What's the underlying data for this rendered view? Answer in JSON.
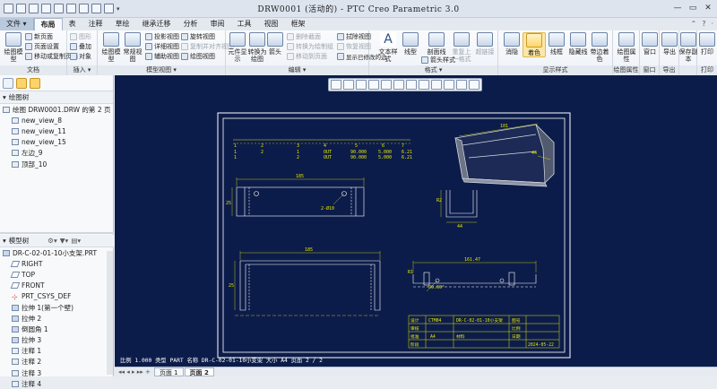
{
  "titlebar": {
    "title": "DRW0001 (活动的) - PTC Creo Parametric 3.0",
    "minimize": "—",
    "maximize": "▭",
    "close": "✕"
  },
  "menu": {
    "file": "文件 ▾",
    "tabs": [
      "布局",
      "表",
      "注释",
      "草绘",
      "继承迁移",
      "分析",
      "审阅",
      "工具",
      "视图",
      "框架"
    ],
    "active_tab": "布局",
    "right_icons": [
      "⌃",
      "?",
      "·"
    ]
  },
  "ribbon": {
    "groups": {
      "document": {
        "label": "文档",
        "big_button": "绘图模型",
        "items": [
          "新页面",
          "页面设置",
          "移动或复制页面"
        ]
      },
      "insert": {
        "label": "插入 ▾",
        "items": [
          "图形",
          "叠加",
          "对象"
        ]
      },
      "model_views": {
        "label": "模型视图 ▾",
        "big_buttons": [
          "绘图模型",
          "常规视图"
        ],
        "items": [
          "投影视图",
          "详细视图",
          "辅助视图",
          "旋转视图",
          "复制并对齐视图",
          "绘图视图"
        ]
      },
      "edit": {
        "label": "编辑 ▾",
        "big_buttons": [
          "元件显示",
          "转换为绘图",
          "箭头"
        ],
        "items": [
          "删除截面",
          "转换为绘制组",
          "移动到页面",
          "拭除视图",
          "恢复视图",
          "显示已修改的边"
        ]
      },
      "format": {
        "label": "格式 ▾",
        "big_buttons": [
          "文本样式",
          "线型",
          "剖面线",
          "重复上一格式",
          "超链接"
        ],
        "items": [
          "箭头样式"
        ]
      },
      "display_style": {
        "label": "显示样式",
        "big_buttons": [
          "消隐",
          "着色",
          "线框",
          "隐藏线",
          "带边着色"
        ],
        "selected": "着色"
      },
      "sheet_props": {
        "label": "绘图属性",
        "big_button": "绘图属性"
      },
      "window": {
        "label": "窗口",
        "big_button": "窗口"
      },
      "export": {
        "label": "导出",
        "big_button": "导出"
      },
      "save_copy": {
        "label": "",
        "big_button": "保存副本"
      },
      "print": {
        "label": "打印",
        "big_button": "打印"
      }
    }
  },
  "drawing_tree": {
    "header": "绘图树",
    "items": [
      {
        "label": "绘图 DRW0001.DRW 的第 2 页",
        "level": 0
      },
      {
        "label": "new_view_8",
        "level": 1
      },
      {
        "label": "new_view_11",
        "level": 1
      },
      {
        "label": "new_view_15",
        "level": 1
      },
      {
        "label": "左边_9",
        "level": 1
      },
      {
        "label": "顶部_10",
        "level": 1
      }
    ]
  },
  "model_tree": {
    "header": "模型树",
    "items": [
      {
        "label": "DR-C-02-01-10小支架.PRT",
        "level": 0,
        "kind": "part"
      },
      {
        "label": "RIGHT",
        "level": 1,
        "kind": "plane"
      },
      {
        "label": "TOP",
        "level": 1,
        "kind": "plane"
      },
      {
        "label": "FRONT",
        "level": 1,
        "kind": "plane"
      },
      {
        "label": "PRT_CSYS_DEF",
        "level": 1,
        "kind": "csys"
      },
      {
        "label": "拉伸 1(第一个壁)",
        "level": 1,
        "kind": "feat"
      },
      {
        "label": "拉伸 2",
        "level": 1,
        "kind": "feat"
      },
      {
        "label": "倒圆角 1",
        "level": 1,
        "kind": "feat"
      },
      {
        "label": "拉伸 3",
        "level": 1,
        "kind": "feat"
      },
      {
        "label": "注释 1",
        "level": 1,
        "kind": "feat"
      },
      {
        "label": "注释 2",
        "level": 1,
        "kind": "feat"
      },
      {
        "label": "注释 3",
        "level": 1,
        "kind": "feat"
      },
      {
        "label": "注释 4",
        "level": 1,
        "kind": "feat"
      }
    ]
  },
  "drawing": {
    "table_rows": [
      [
        "1",
        "2",
        "3",
        "4",
        "5",
        "6",
        "7"
      ],
      [
        "1",
        "2",
        "1",
        "OUT",
        "90.000",
        "5.000",
        "6.21"
      ],
      [
        "1",
        "",
        "2",
        "OUT",
        "90.000",
        "5.000",
        "6.21"
      ]
    ],
    "dims": {
      "top_width": "185",
      "front_width": "185",
      "section_width": "161.47",
      "iso_dim1": "101",
      "iso_dim2": "44",
      "hole": "2-Ø10",
      "r_side": "R2",
      "r_section": "R1",
      "angle": "90.00°",
      "height": "25"
    },
    "title_block": {
      "row1": [
        "设计",
        "CTM04",
        "DR-C-02-01-10小支架",
        "图号",
        ""
      ],
      "row2": [
        "审核",
        "",
        "",
        "比例",
        ""
      ],
      "row3": [
        "批准",
        "A4",
        "材料",
        "日期",
        ""
      ],
      "row4": [
        "阶段",
        "",
        "",
        "",
        "2024-05-22"
      ]
    },
    "status_line": "比例 1.000   类型 PART   名称 DR-C-02-01-10小支架   大小 A4   页面 2 / 2"
  },
  "bottom": {
    "nav": "◂◂ ◂ ▸ ▸▸ +",
    "pages": [
      "页面 1",
      "页面 2"
    ],
    "active_page": "页面 2"
  }
}
